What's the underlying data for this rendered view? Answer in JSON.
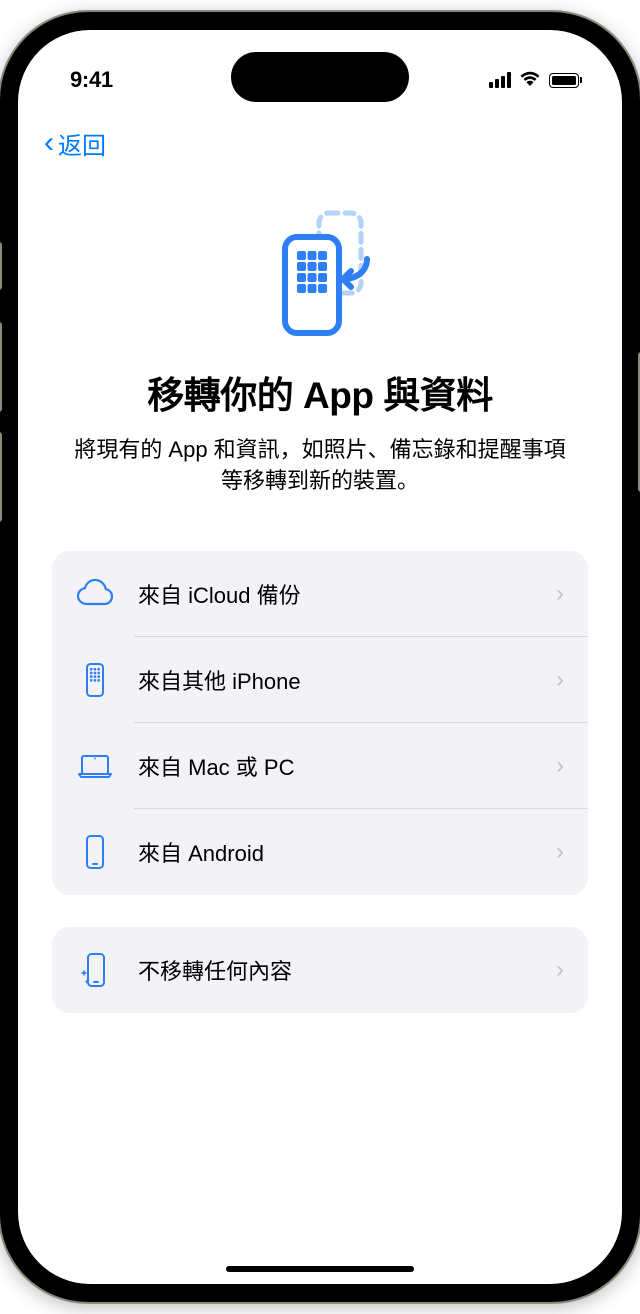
{
  "status": {
    "time": "9:41"
  },
  "nav": {
    "back": "返回"
  },
  "header": {
    "title": "移轉你的 App 與資料",
    "subtitle": "將現有的 App 和資訊，如照片、備忘錄和提醒事項等移轉到新的裝置。"
  },
  "options": {
    "primary": [
      {
        "label": "來自 iCloud 備份"
      },
      {
        "label": "來自其他 iPhone"
      },
      {
        "label": "來自 Mac 或 PC"
      },
      {
        "label": "來自 Android"
      }
    ],
    "secondary": [
      {
        "label": "不移轉任何內容"
      }
    ]
  }
}
